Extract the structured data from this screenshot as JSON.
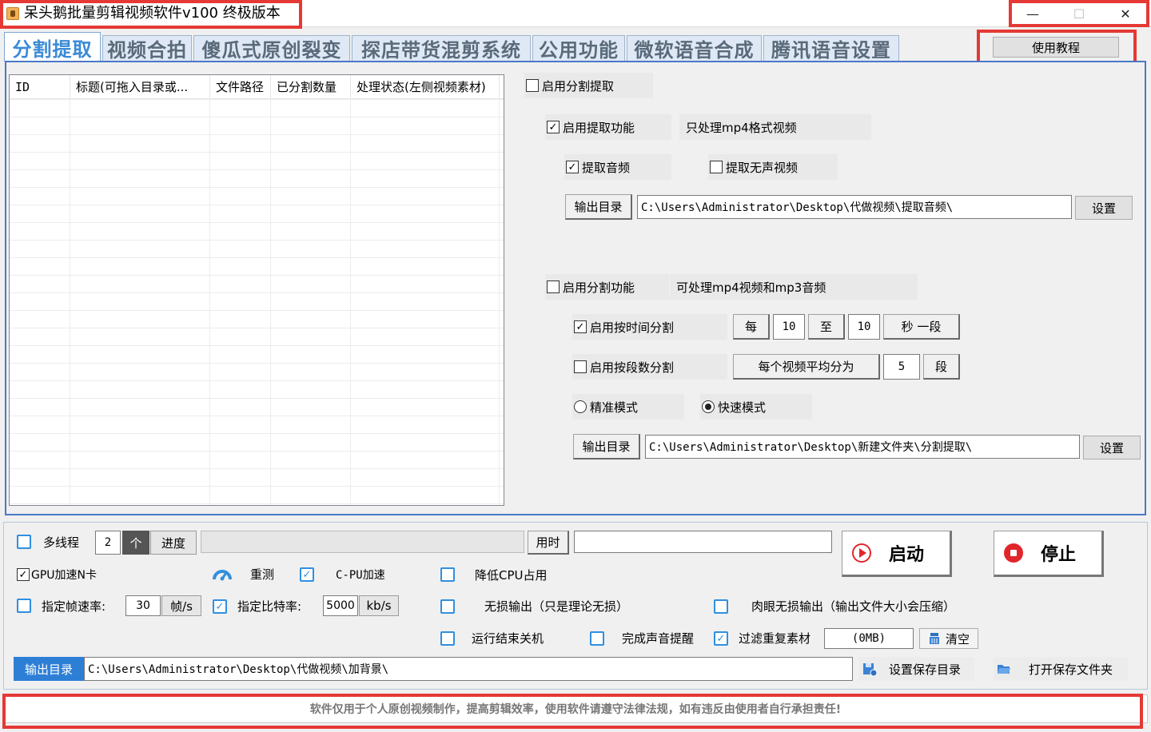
{
  "window": {
    "title": "呆头鹅批量剪辑视频软件v100 终极版本",
    "minimize": "—",
    "maximize": "☐",
    "close": "✕"
  },
  "tabs": [
    "分割提取",
    "视频合拍",
    "傻瓜式原创裂变",
    "探店带货混剪系统",
    "公用功能",
    "微软语音合成",
    "腾讯语音设置"
  ],
  "tutorial_button": "使用教程",
  "list": {
    "columns": [
      "ID",
      "标题(可拖入目录或...",
      "文件路径",
      "已分割数量",
      "处理状态(左侧视频素材)"
    ]
  },
  "split_extract": {
    "enable_split_extract": "启用分割提取",
    "enable_extract": "启用提取功能",
    "extract_note": "只处理mp4格式视频",
    "extract_audio": "提取音频",
    "extract_silent": "提取无声视频",
    "output_dir_label": "输出目录",
    "extract_output_path": "C:\\Users\\Administrator\\Desktop\\代做视频\\提取音频\\",
    "set_button": "设置",
    "enable_split": "启用分割功能",
    "split_note": "可处理mp4视频和mp3音频",
    "split_by_time": "启用按时间分割",
    "every": "每",
    "time_from": "10",
    "to": "至",
    "time_to": "10",
    "seconds_segment": "秒 一段",
    "split_by_count": "启用按段数分割",
    "avg_split": "每个视频平均分为",
    "segment_count": "5",
    "segment_unit": "段",
    "precise_mode": "精准模式",
    "fast_mode": "快速模式",
    "split_output_path": "C:\\Users\\Administrator\\Desktop\\新建文件夹\\分割提取\\"
  },
  "bottom": {
    "multithread": "多线程",
    "thread_count": "2",
    "thread_unit": "个",
    "progress_label": "进度",
    "time_used_label": "用时",
    "time_used_value": "",
    "start_button": "启动",
    "stop_button": "停止",
    "gpu_accel": "GPU加速N卡",
    "retest": "重测",
    "cpu_accel": "C-PU加速",
    "reduce_cpu": "降低CPU占用",
    "specify_fps": "指定帧速率:",
    "fps_value": "30",
    "fps_unit": "帧/s",
    "specify_bitrate": "指定比特率:",
    "bitrate_value": "5000",
    "bitrate_unit": "kb/s",
    "lossless": "无损输出（只是理论无损）",
    "visual_lossless": "肉眼无损输出（输出文件大小会压缩）",
    "shutdown": "运行结束关机",
    "sound_alert": "完成声音提醒",
    "filter_duplicates": "过滤重复素材",
    "dup_size": "(0MB)",
    "clear": "清空",
    "output_dir_label": "输出目录",
    "output_path": "C:\\Users\\Administrator\\Desktop\\代做视频\\加背景\\",
    "set_save_dir": "设置保存目录",
    "open_save_folder": "打开保存文件夹"
  },
  "status": "软件仅用于个人原创视频制作，提高剪辑效率，使用软件请遵守法律法规，如有违反由使用者自行承担责任!",
  "colors": {
    "accent_blue": "#3a8ad6",
    "highlight_red": "#e53935",
    "stop_red": "#e0262b"
  }
}
